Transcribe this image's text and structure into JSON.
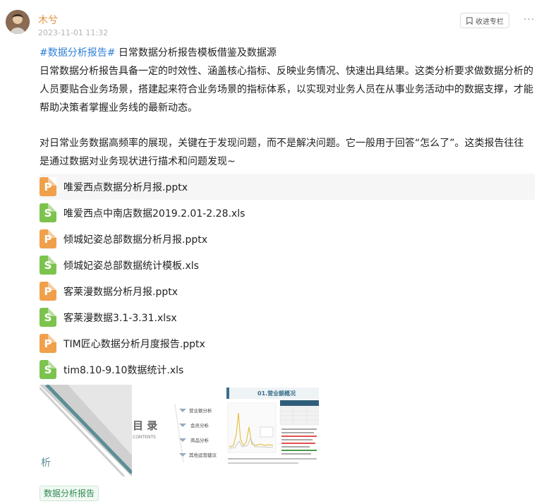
{
  "post": {
    "author": "木兮",
    "time": "2023-11-01 11:32",
    "collect_label": "收进专栏",
    "more_label": "···",
    "hashtag": "#数据分析报告#",
    "title": " 日常数据分析报告模板借鉴及数据源",
    "paragraph1": "日常数据分析报告具备一定的时效性、涵盖核心指标、反映业务情况、快速出具结果。这类分析要求做数据分析的人员要贴合业务场景，搭建起来符合业务场景的指标体系，以实现对业务人员在从事业务活动中的数据支撑，才能帮助决策者掌握业务线的最新动态。",
    "paragraph2": "对日常业务数据高频率的展现，关键在于发现问题，而不是解决问题。它一般用于回答“怎么了”。这类报告往往是通过数据对业务现状进行描术和问题发现~",
    "tag": "数据分析报告"
  },
  "files": [
    {
      "icon": "P",
      "name": "唯爱西点数据分析月报.pptx"
    },
    {
      "icon": "S",
      "name": "唯爱西点中南店数据2019.2.01-2.28.xls"
    },
    {
      "icon": "P",
      "name": "倾城妃姿总部数据分析月报.pptx"
    },
    {
      "icon": "S",
      "name": "倾城妃姿总部数据统计模板.xls"
    },
    {
      "icon": "P",
      "name": "客莱漫数据分析月报.pptx"
    },
    {
      "icon": "S",
      "name": "客莱漫数据3.1-3.31.xlsx"
    },
    {
      "icon": "P",
      "name": "TIM匠心数据分析月度报告.pptx"
    },
    {
      "icon": "S",
      "name": "tim8.10-9.10数据统计.xls"
    }
  ],
  "thumbnails": {
    "thumb1": {
      "text": "析"
    },
    "thumb2": {
      "title": "目 录",
      "subtitle": "CONTENTS",
      "items": [
        "营业额分析",
        "会员分析",
        "商品分析",
        "其他运营建议"
      ]
    },
    "thumb3": {
      "title": "01.营业额概况"
    }
  },
  "colors": {
    "accent": "#2f7fd6",
    "author": "#e0913a",
    "ppt_icon": "#f0a04b",
    "xls_icon": "#7cc34e",
    "tag_text": "#2e8a53"
  }
}
